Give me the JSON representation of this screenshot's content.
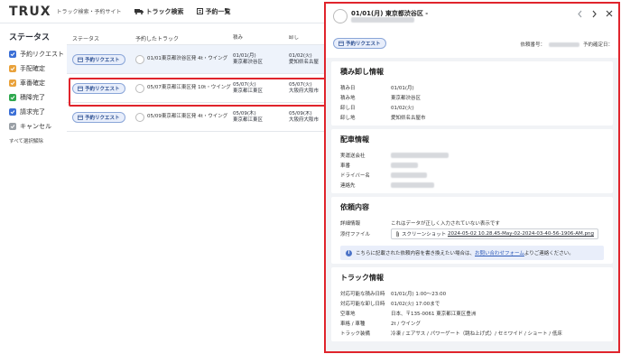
{
  "header": {
    "logo": "TRUX",
    "subtitle": "トラック検索・予約サイト",
    "nav_truck_search": "トラック検索",
    "nav_reservations": "予約一覧"
  },
  "sidebar": {
    "title": "ステータス",
    "items": [
      {
        "label": "予約リクエスト",
        "color": "#3b6fd6"
      },
      {
        "label": "手配確定",
        "color": "#e9a23b"
      },
      {
        "label": "車番確定",
        "color": "#e9a23b"
      },
      {
        "label": "積降完了",
        "color": "#2fa84f"
      },
      {
        "label": "請求完了",
        "color": "#3b6fd6"
      },
      {
        "label": "キャンセル",
        "color": "#9aa0a6"
      }
    ],
    "clear_all": "すべて選択解除"
  },
  "table": {
    "headers": [
      "ステータス",
      "予約したトラック",
      "積み",
      "卸し"
    ],
    "rows": [
      {
        "status": "予約リクエスト",
        "truck": "01/01東京都渋谷区発 4t・ウイング",
        "load_date": "01/01(月)",
        "load_place": "東京都渋谷区",
        "unload_date": "01/02(火)",
        "unload_place": "愛知県名古屋"
      },
      {
        "status": "予約リクエスト",
        "truck": "05/07東京都江東区発 10t・ウイング",
        "load_date": "05/07(火)",
        "load_place": "東京都江東区",
        "unload_date": "05/07(火)",
        "unload_place": "大阪府大阪市"
      },
      {
        "status": "予約リクエスト",
        "truck": "05/09東京都江東区発 4t・ウイング",
        "load_date": "05/09(木)",
        "load_place": "東京都江東区",
        "unload_date": "05/09(木)",
        "unload_place": "大阪府大阪市"
      }
    ]
  },
  "panel": {
    "title": "01/01(月) 東京都渋谷区 -",
    "badge": "予約リクエスト",
    "req_no_label": "依頼番号：",
    "date_label": "予約確定日：",
    "loading": {
      "title": "積み卸し情報",
      "rows": [
        {
          "k": "積み日",
          "v": "01/01(月)"
        },
        {
          "k": "積み地",
          "v": "東京都渋谷区"
        },
        {
          "k": "卸し日",
          "v": "01/02(火)"
        },
        {
          "k": "卸し地",
          "v": "愛知県名古屋市"
        }
      ]
    },
    "dispatch": {
      "title": "配車情報",
      "rows": [
        {
          "k": "実運送会社"
        },
        {
          "k": "車番"
        },
        {
          "k": "ドライバー名"
        },
        {
          "k": "連絡先"
        }
      ]
    },
    "request": {
      "title": "依頼内容",
      "detail_label": "詳細情報",
      "detail_value": "これはデータが正しく入力されていない表示です",
      "attach_label": "添付ファイル",
      "attach_prefix": "スクリーンショット",
      "attach_file": "2024-05-02 10.28.45-May-02-2024-03-40-56-1906-AM.png",
      "notice_before": "こちらに記載された依頼内容を書き換えたい場合は、",
      "notice_link": "お問い合わせフォーム",
      "notice_after": "よりご連絡ください。"
    },
    "truck": {
      "title": "トラック情報",
      "rows": [
        {
          "k": "対応可能な積み日時",
          "v": "01/01(月) 1:00〜23:00"
        },
        {
          "k": "対応可能な卸し日時",
          "v": "01/02(火) 17:00まで"
        },
        {
          "k": "空車地",
          "v": "日本、〒135-0061 東京都江東区豊洲"
        },
        {
          "k": "車格 / 車種",
          "v": "2t / ウイング"
        },
        {
          "k": "トラック装備",
          "v": "冷凍 / エアサス / パワーゲート（跳ね上げ式）/ セミワイド / ショート / 低床"
        }
      ]
    }
  }
}
